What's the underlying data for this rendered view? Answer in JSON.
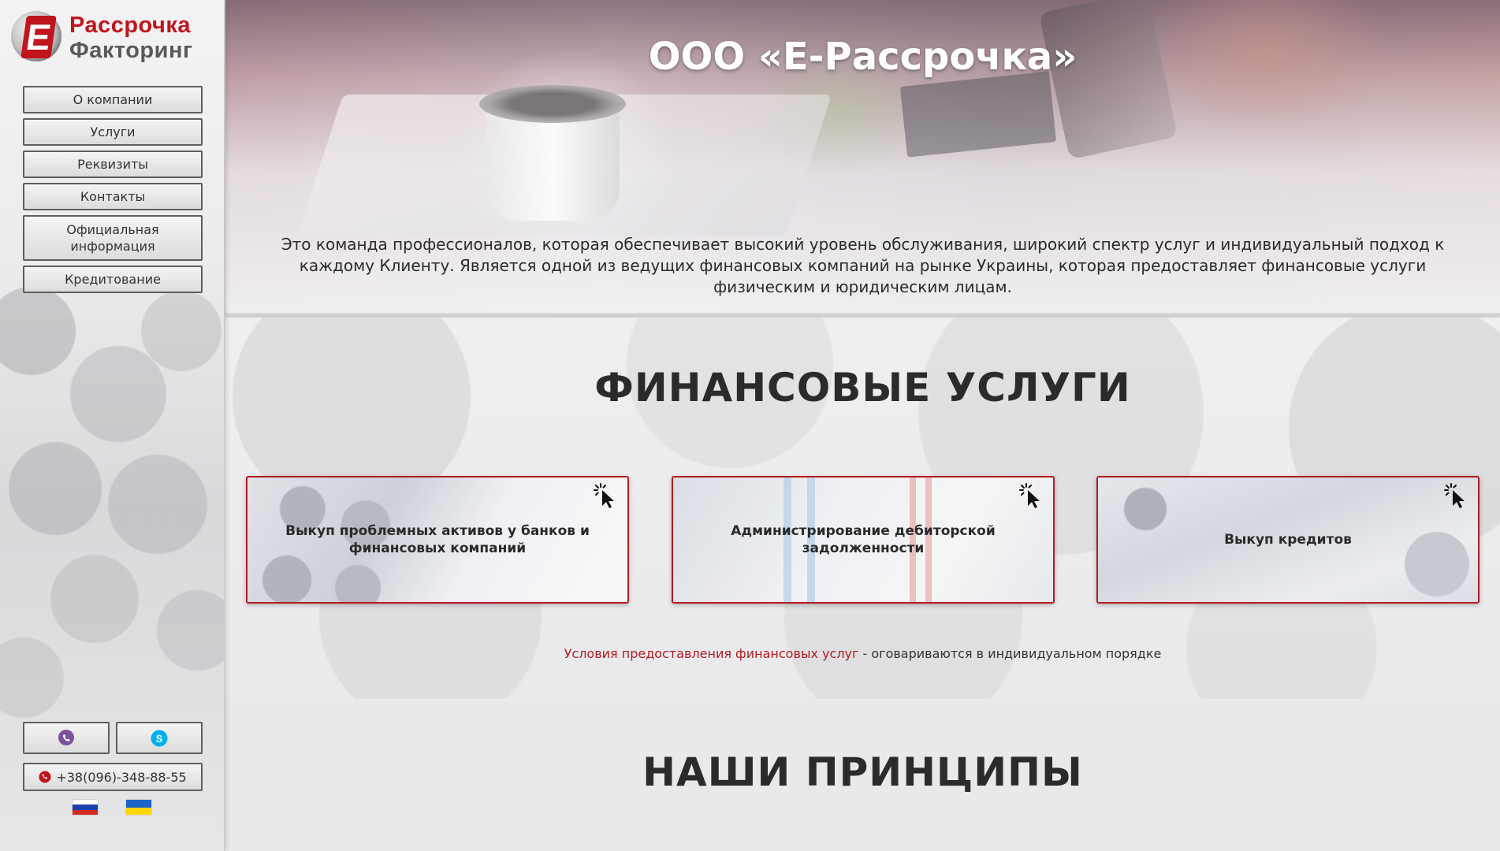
{
  "sidebar": {
    "logo": {
      "line1": "Рассрочка",
      "line2": "Факторинг",
      "mark": "E"
    },
    "nav": [
      {
        "label": "О компании"
      },
      {
        "label": "Услуги"
      },
      {
        "label": "Реквизиты"
      },
      {
        "label": "Контакты"
      },
      {
        "label": "Официальная\nинформация"
      },
      {
        "label": "Кредитование"
      }
    ],
    "messengers": [
      {
        "icon": "viber-icon",
        "color": "#7b519d"
      },
      {
        "icon": "skype-icon",
        "color": "#00aff0"
      }
    ],
    "phone": {
      "number": "+38(096)-348-88-55",
      "icon": "phone-icon",
      "color": "#c0151c"
    },
    "languages": [
      {
        "icon": "russian-flag-icon",
        "colors": [
          "#ffffff",
          "#1c3fae",
          "#d52b1e"
        ]
      },
      {
        "icon": "ukrainian-flag-icon",
        "colors": [
          "#1c63c7",
          "#ffd500"
        ]
      }
    ]
  },
  "hero": {
    "title": "ООО «Е-Рассрочка»",
    "description": "Это команда профессионалов, которая обеспечивает высокий уровень обслуживания, широкий спектр услуг и индивидуальный подход к каждому Клиенту. Является одной из ведущих финансовых компаний на рынке Украины, которая предоставляет финансовые услуги физическим и юридическим лицам."
  },
  "services": {
    "title": "ФИНАНСОВЫЕ УСЛУГИ",
    "cards": [
      {
        "label": "Выкуп проблемных активов у банков и финансовых компаний",
        "icon": "cursor-click-icon"
      },
      {
        "label": "Администрирование дебиторской задолженности",
        "icon": "cursor-click-icon"
      },
      {
        "label": "Выкуп кредитов",
        "icon": "cursor-click-icon"
      }
    ],
    "note_link": "Условия предоставления финансовых услуг",
    "note_text": " - оговариваются в индивидуальном порядке",
    "accent": "#b31b22"
  },
  "principles": {
    "title": "НАШИ ПРИНЦИПЫ"
  }
}
